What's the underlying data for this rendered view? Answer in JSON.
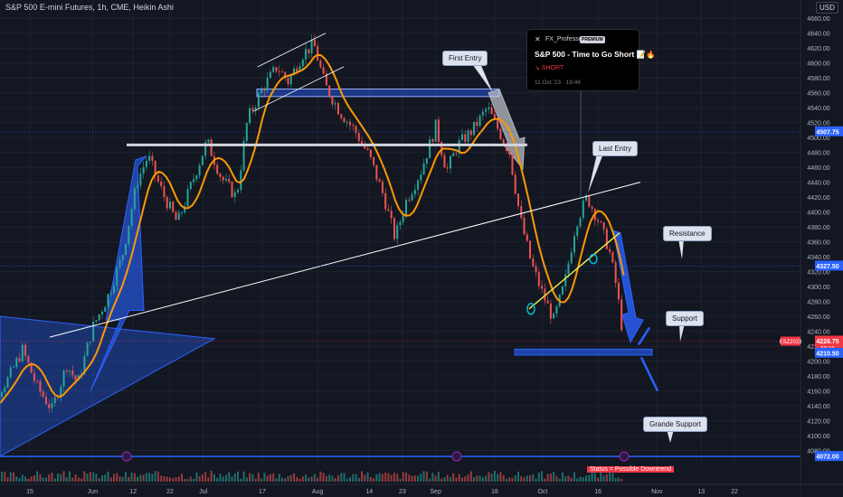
{
  "header": {
    "title": "S&P 500 E-mini Futures, 1h, CME, Heikin Ashi",
    "currency": "USD"
  },
  "idea_card": {
    "author": "FX_Professor",
    "badge": "PREMIUM",
    "title": "S&P 500 - Time to Go Short 📝🔥",
    "signal": "↘ SHORT",
    "date": "11 Oct '23 · 19:46"
  },
  "annotations": {
    "first_entry": "First Entry",
    "last_entry": "Last Entry",
    "resistance": "Resistance",
    "support": "Support",
    "grande_support": "Grande Support"
  },
  "status_bar": "Status = Possible Downtrend",
  "colors": {
    "background": "#131722",
    "up_candle": "#26a69a",
    "down_candle": "#ef5350",
    "moving_average": "#ff9800",
    "trendline": "#ffffff",
    "zone": "#2962ff",
    "price_tag": "#f23645",
    "level_tag": "#2962ff",
    "yellow_line": "#e7e84a",
    "cyan_marker": "#00bcd4"
  },
  "chart_data": {
    "type": "candlestick",
    "symbol": "ESZ2023",
    "timeframe": "1h",
    "style": "Heikin Ashi",
    "y_axis": {
      "range": [
        4060,
        4670
      ],
      "ticks": [
        4080,
        4100,
        4120,
        4140,
        4160,
        4180,
        4200,
        4220,
        4240,
        4260,
        4280,
        4300,
        4320,
        4340,
        4360,
        4380,
        4400,
        4420,
        4440,
        4460,
        4480,
        4500,
        4520,
        4540,
        4560,
        4580,
        4600,
        4620,
        4640,
        4660
      ],
      "tick_labels": [
        "4080.00",
        "4100.00",
        "4120.00",
        "4140.00",
        "4160.00",
        "4180.00",
        "4200.00",
        "4220.00",
        "4240.00",
        "4260.00",
        "4280.00",
        "4300.00",
        "4320.00",
        "4340.00",
        "4360.00",
        "4380.00",
        "4400.00",
        "4420.00",
        "4440.00",
        "4460.00",
        "4480.00",
        "4500.00",
        "4520.00",
        "4540.00",
        "4560.00",
        "4580.00",
        "4600.00",
        "4620.00",
        "4640.00",
        "4660.00"
      ]
    },
    "x_axis": {
      "tick_labels": [
        "15",
        "Jun",
        "12",
        "22",
        "Jul",
        "17",
        "Aug",
        "14",
        "23",
        "Sep",
        "18",
        "Oct",
        "16",
        "Nov",
        "13",
        "22"
      ],
      "tick_days": [
        14,
        31,
        42,
        52,
        61,
        77,
        92,
        106,
        115,
        124,
        140,
        153,
        168,
        184,
        196,
        205
      ]
    },
    "price_levels": [
      {
        "label": "4507.75",
        "value": 4507.75
      },
      {
        "label": "4327.50",
        "value": 4327.5
      },
      {
        "label": "4226.75",
        "value": 4226.75,
        "symbol": "ESZ2023",
        "timer": "50:18",
        "current": true
      },
      {
        "label": "4210.50",
        "value": 4210.5
      },
      {
        "label": "4072.00",
        "value": 4072
      }
    ],
    "price_path": [
      {
        "day": 0,
        "price": 4125
      },
      {
        "day": 4,
        "price": 4150
      },
      {
        "day": 8,
        "price": 4175
      },
      {
        "day": 12,
        "price": 4215
      },
      {
        "day": 16,
        "price": 4165
      },
      {
        "day": 20,
        "price": 4135
      },
      {
        "day": 24,
        "price": 4195
      },
      {
        "day": 27,
        "price": 4170
      },
      {
        "day": 31,
        "price": 4245
      },
      {
        "day": 35,
        "price": 4285
      },
      {
        "day": 39,
        "price": 4340
      },
      {
        "day": 43,
        "price": 4440
      },
      {
        "day": 46,
        "price": 4475
      },
      {
        "day": 50,
        "price": 4425
      },
      {
        "day": 54,
        "price": 4385
      },
      {
        "day": 58,
        "price": 4440
      },
      {
        "day": 62,
        "price": 4495
      },
      {
        "day": 66,
        "price": 4445
      },
      {
        "day": 70,
        "price": 4420
      },
      {
        "day": 73,
        "price": 4525
      },
      {
        "day": 77,
        "price": 4565
      },
      {
        "day": 81,
        "price": 4595
      },
      {
        "day": 84,
        "price": 4575
      },
      {
        "day": 88,
        "price": 4612
      },
      {
        "day": 91,
        "price": 4625
      },
      {
        "day": 94,
        "price": 4570
      },
      {
        "day": 98,
        "price": 4535
      },
      {
        "day": 102,
        "price": 4510
      },
      {
        "day": 106,
        "price": 4475
      },
      {
        "day": 110,
        "price": 4420
      },
      {
        "day": 113,
        "price": 4365
      },
      {
        "day": 116,
        "price": 4415
      },
      {
        "day": 120,
        "price": 4455
      },
      {
        "day": 124,
        "price": 4515
      },
      {
        "day": 127,
        "price": 4455
      },
      {
        "day": 130,
        "price": 4490
      },
      {
        "day": 134,
        "price": 4510
      },
      {
        "day": 138,
        "price": 4540
      },
      {
        "day": 141,
        "price": 4510
      },
      {
        "day": 144,
        "price": 4480
      },
      {
        "day": 147,
        "price": 4390
      },
      {
        "day": 150,
        "price": 4330
      },
      {
        "day": 153,
        "price": 4290
      },
      {
        "day": 156,
        "price": 4255
      },
      {
        "day": 159,
        "price": 4305
      },
      {
        "day": 162,
        "price": 4385
      },
      {
        "day": 165,
        "price": 4420
      },
      {
        "day": 168,
        "price": 4390
      },
      {
        "day": 171,
        "price": 4350
      },
      {
        "day": 173,
        "price": 4300
      },
      {
        "day": 175,
        "price": 4226.75
      }
    ],
    "levels": {
      "first_entry_zone": [
        4555,
        4565
      ],
      "support_zone": [
        4208,
        4216
      ],
      "horizontal_resistance": 4490,
      "grande_support": 4072
    }
  }
}
